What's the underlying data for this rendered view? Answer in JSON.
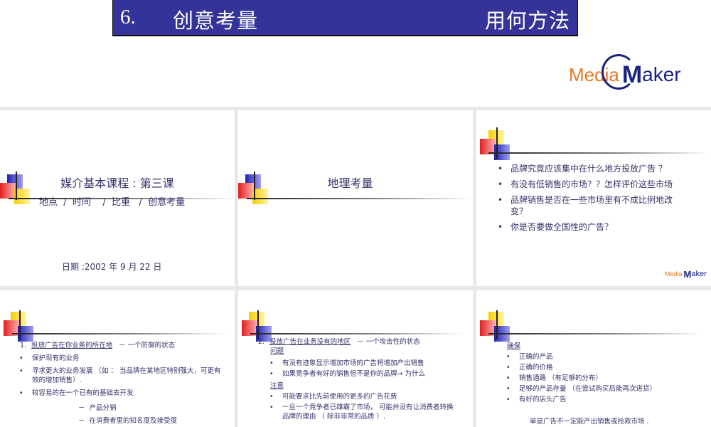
{
  "header": {
    "number": "6.",
    "title": "创意考量",
    "subtitle": "用何方法"
  },
  "logo": {
    "media": "Media",
    "maker_m": "M",
    "maker_rest": "aker"
  },
  "slide1": {
    "title": "媒介基本课程 : 第三课",
    "topics": "地点  /  时间    /  比重   /  创意考量",
    "date": "日期 :2002 年 9 月 22 日"
  },
  "slide2": {
    "title": "地理考量"
  },
  "slide3": {
    "bullets": [
      "品牌究竟应该集中在什么地方投放广告  ？",
      "有没有低销售的市场？？怎样评价这些市场",
      "品牌销售是否在一些市场里有不成比例地改变？",
      "你是否要做全国性的广告？"
    ]
  },
  "slide4": {
    "num": "1.",
    "heading": "投放广告在你业务的所在地",
    "heading_suffix": "－ 一个防御的状态",
    "bullets": [
      "保护现有的业务",
      "寻求更大的业务发展 （如 ： 当品牌在某地区特别强大，可更有效的增加销售）.",
      "较容易的在一个已有的基础去开发"
    ],
    "sub": [
      "产品分销",
      "在消费者里的知名度及接受度"
    ]
  },
  "slide5": {
    "num": "2.",
    "heading": "投放广告在业务没有的地区",
    "heading_suffix": "－ 一个攻击性的状态",
    "label1": "问题",
    "bullets1": [
      "有没有迹象显示增加市场的广告将增加产出销售",
      "如果竞争者有好的销售但不是你的品牌→ 为什么"
    ],
    "label2": "注意",
    "bullets2": [
      "可能要求比先前使用的更多的广告花费",
      "一旦一个竞争者已雄霸了市场， 可能并没有让消费者转换品牌的理由 （  除非非常的品质  ）."
    ]
  },
  "slide6": {
    "label": "确保",
    "bullets": [
      "正确的产品",
      "正确的价格",
      "销售通路 （有足够的分布）",
      "足够的产品存量 （在尝试购买后能再次进货）",
      "有好的店头广告"
    ],
    "footer": "单是广告不一定能产出销售或抢救市场 ."
  }
}
